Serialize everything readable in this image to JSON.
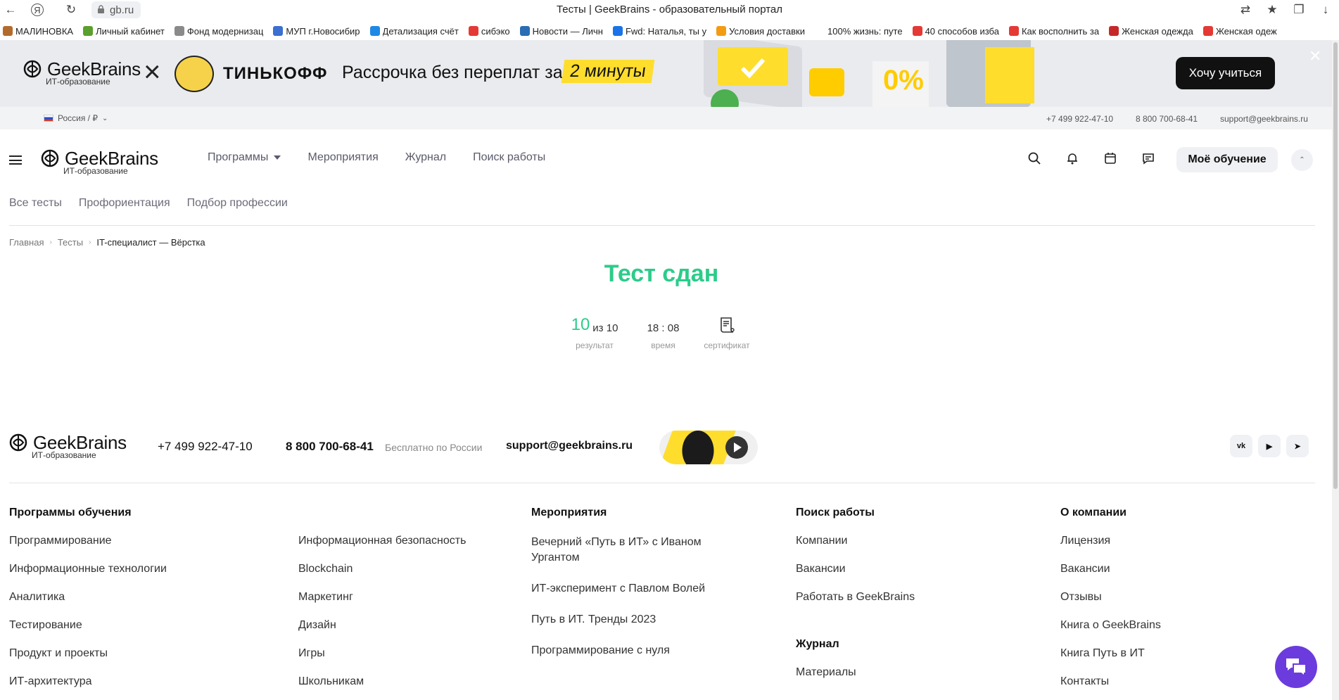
{
  "browser": {
    "url": "gb.ru",
    "title": "Тесты | GeekBrains - образовательный портал",
    "bookmarks": [
      {
        "label": "МАЛИНОВКА",
        "color": "#b36b2c"
      },
      {
        "label": "Личный кабинет",
        "color": "#5aa02c"
      },
      {
        "label": "Фонд модернизац",
        "color": "#8a8a8a"
      },
      {
        "label": "МУП г.Новосибир",
        "color": "#3b6fd0"
      },
      {
        "label": "Детализация счёт",
        "color": "#1e88e5"
      },
      {
        "label": "сибэко",
        "color": "#e53935"
      },
      {
        "label": "Новости — Личн",
        "color": "#2a6db5"
      },
      {
        "label": "Fwd: Наталья, ты у",
        "color": "#1a73e8"
      },
      {
        "label": "Условия доставки",
        "color": "#f39c12"
      },
      {
        "label": "100% жизнь: путе",
        "color": "#ffffff"
      },
      {
        "label": "40 способов изба",
        "color": "#e53935"
      },
      {
        "label": "Как восполнить за",
        "color": "#e53935"
      },
      {
        "label": "Женская одежда",
        "color": "#c62828"
      },
      {
        "label": "Женская одеж",
        "color": "#e53935"
      }
    ]
  },
  "promo": {
    "brand": "GeekBrains",
    "brand_sub": "ИТ-образование",
    "partner": "ТИНЬКОФФ",
    "text": "Рассрочка без переплат за",
    "highlight": "2 минуты",
    "button": "Хочу учиться",
    "close": "✕"
  },
  "contacts": {
    "region": "Россия / ₽",
    "phone1": "+7 499 922-47-10",
    "phone2": "8 800 700-68-41",
    "email": "support@geekbrains.ru"
  },
  "header": {
    "brand": "GeekBrains",
    "brand_sub": "ИТ-образование",
    "nav": [
      "Программы",
      "Мероприятия",
      "Журнал",
      "Поиск работы"
    ],
    "my_learning": "Моё обучение"
  },
  "subnav": [
    "Все тесты",
    "Профориентация",
    "Подбор профессии"
  ],
  "breadcrumb": [
    "Главная",
    "Тесты",
    "IT-специалист — Вёрстка"
  ],
  "result": {
    "title": "Тест сдан",
    "score": "10",
    "score_total": "из 10",
    "score_label": "результат",
    "time": "18 : 08",
    "time_label": "время",
    "cert_label": "сертификат"
  },
  "footer": {
    "brand": "GeekBrains",
    "brand_sub": "ИТ-образование",
    "phone1": "+7 499 922-47-10",
    "phone2": "8 800 700-68-41",
    "free_note": "Бесплатно по России",
    "email": "support@geekbrains.ru",
    "socials": [
      "vk",
      "youtube",
      "telegram"
    ],
    "programs_title": "Программы обучения",
    "programs_col1": [
      "Программирование",
      "Информационные технологии",
      "Аналитика",
      "Тестирование",
      "Продукт и проекты",
      "ИТ-архитектура"
    ],
    "programs_col2": [
      "Информационная безопасность",
      "Blockchain",
      "Маркетинг",
      "Дизайн",
      "Игры",
      "Школьникам"
    ],
    "events_title": "Мероприятия",
    "events": [
      "Вечерний «Путь в ИТ» с Иваном Ургантом",
      "ИТ-эксперимент с Павлом Волей",
      "Путь в ИТ. Тренды 2023",
      "Программирование с нуля"
    ],
    "jobs_title": "Поиск работы",
    "jobs": [
      "Компании",
      "Вакансии",
      "Работать в GeekBrains"
    ],
    "journal_title": "Журнал",
    "journal": [
      "Материалы"
    ],
    "company_title": "О компании",
    "company": [
      "Лицензия",
      "Вакансии",
      "Отзывы",
      "Книга о GeekBrains",
      "Книга Путь в ИТ",
      "Контакты"
    ]
  }
}
